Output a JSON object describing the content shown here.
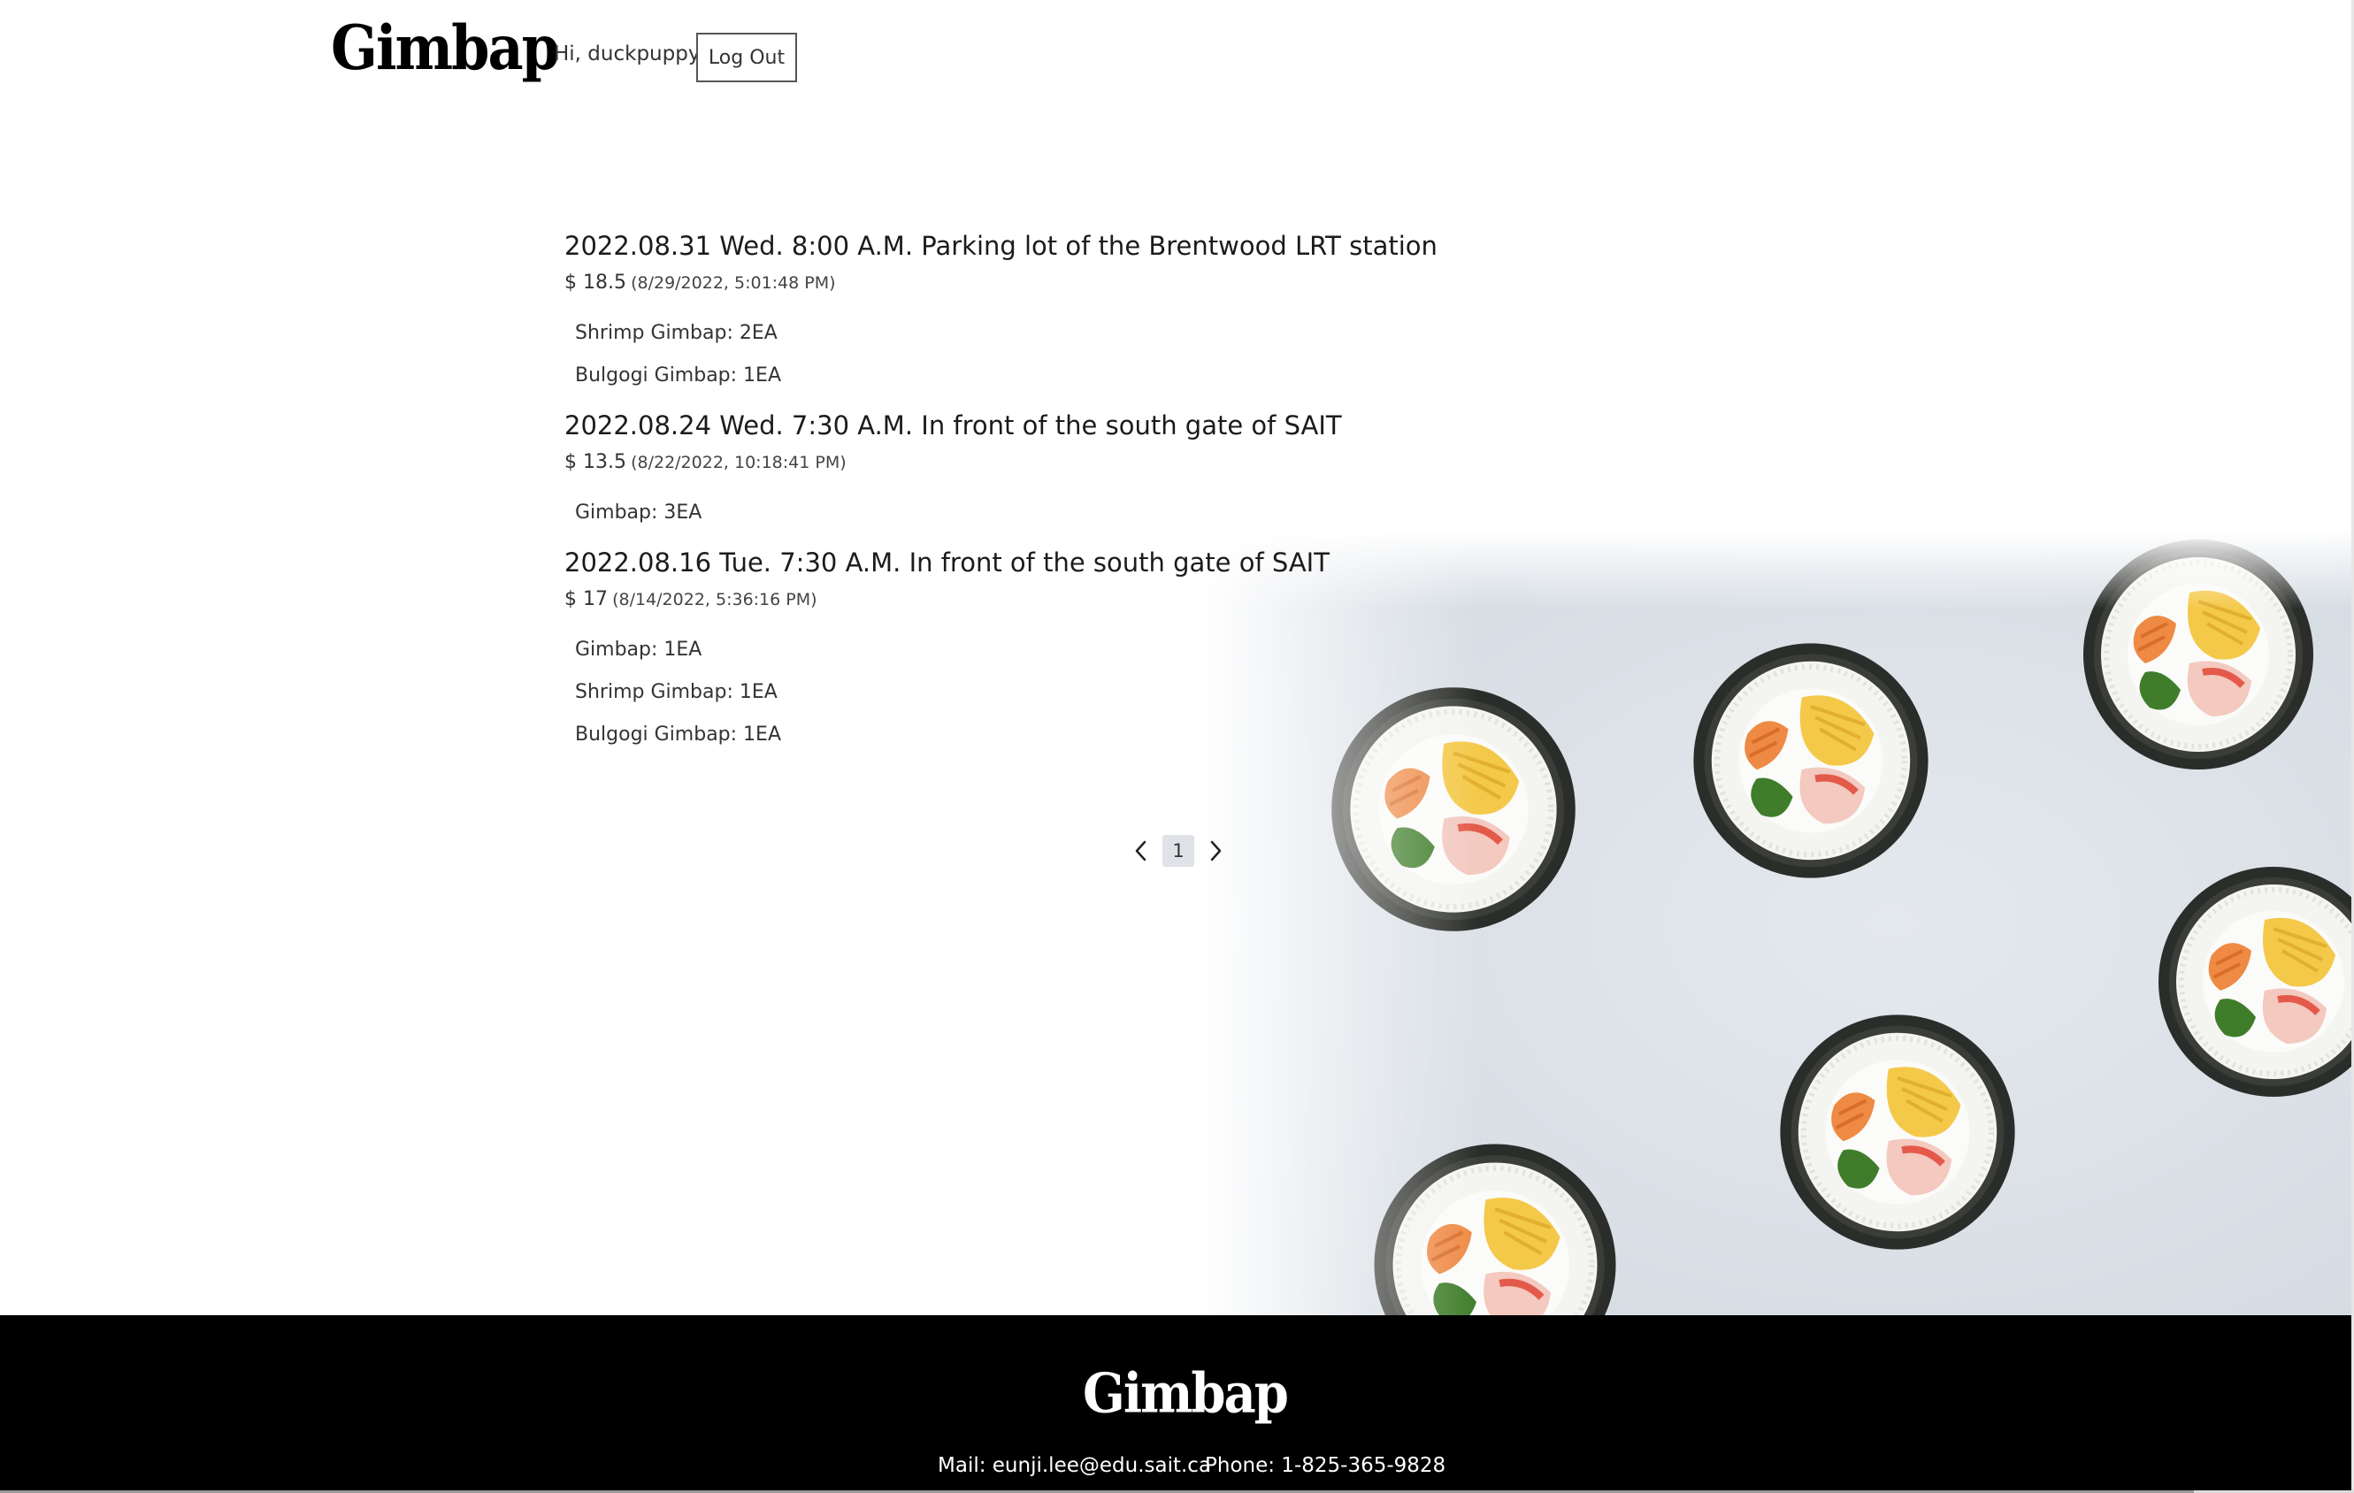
{
  "header": {
    "logo": "Gimbap",
    "greeting": "Hi, duckpuppy",
    "logout_label": "Log Out"
  },
  "orders": [
    {
      "title": "2022.08.31 Wed. 8:00 A.M. Parking lot of the Brentwood LRT station",
      "price": "$ 18.5",
      "ordered_at": "(8/29/2022, 5:01:48 PM)",
      "items": [
        "Shrimp Gimbap: 2EA",
        "Bulgogi Gimbap: 1EA"
      ]
    },
    {
      "title": "2022.08.24 Wed. 7:30 A.M. In front of the south gate of SAIT",
      "price": "$ 13.5",
      "ordered_at": "(8/22/2022, 10:18:41 PM)",
      "items": [
        "Gimbap: 3EA"
      ]
    },
    {
      "title": "2022.08.16 Tue. 7:30 A.M. In front of the south gate of SAIT",
      "price": "$ 17",
      "ordered_at": "(8/14/2022, 5:36:16 PM)",
      "items": [
        "Gimbap: 1EA",
        "Shrimp Gimbap: 1EA",
        "Bulgogi Gimbap: 1EA"
      ]
    }
  ],
  "pagination": {
    "current_page": "1",
    "prev_icon": "chevron-left-icon",
    "next_icon": "chevron-right-icon"
  },
  "footer": {
    "logo": "Gimbap",
    "mail": "Mail: eunji.lee@edu.sait.ca",
    "phone": "Phone: 1-825-365-9828"
  },
  "colors": {
    "footer_background": "#000000",
    "page_background": "#ffffff",
    "active_page_background": "#dfe3e8"
  }
}
